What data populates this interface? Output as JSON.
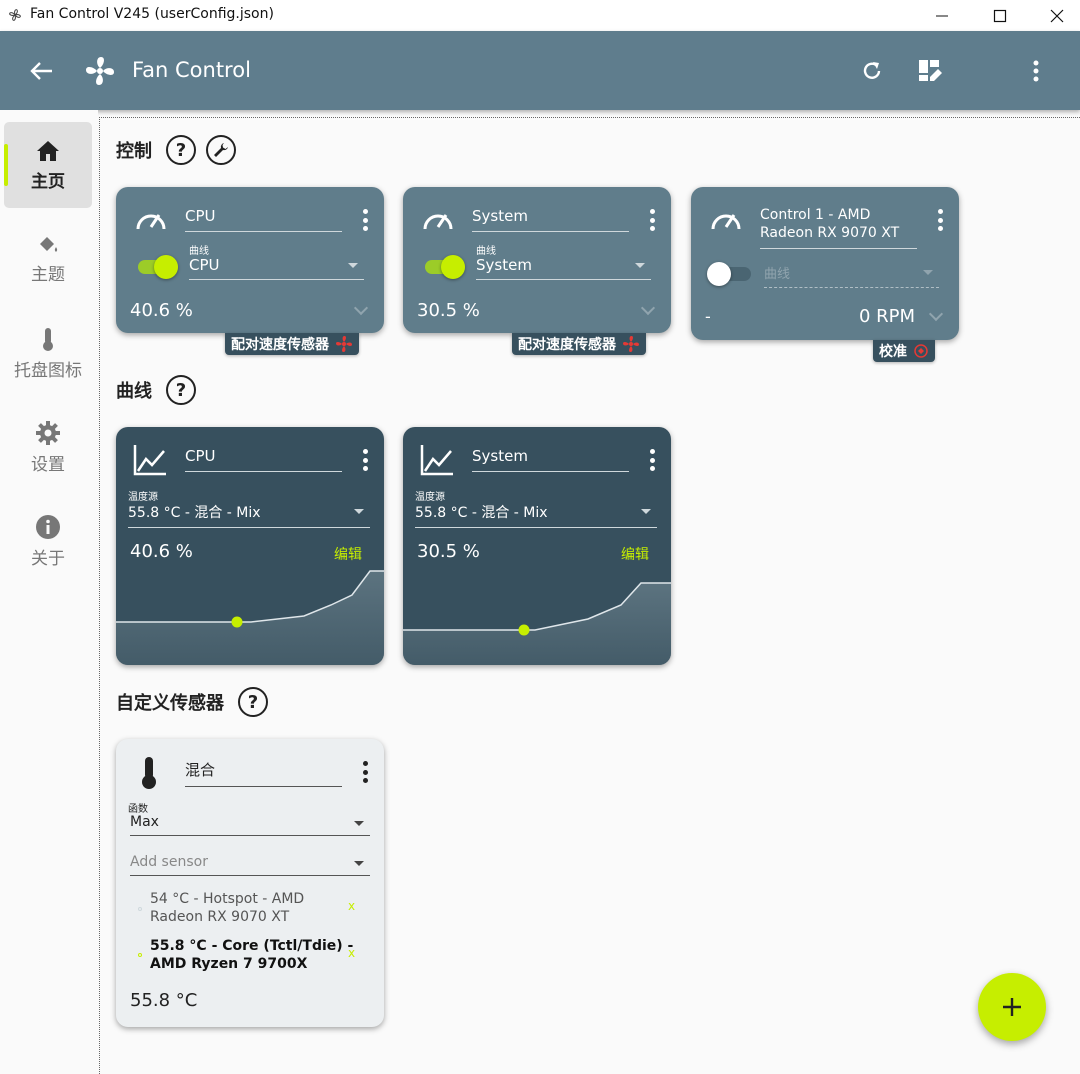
{
  "window": {
    "title": "Fan Control V245 (userConfig.json)"
  },
  "appbar": {
    "title": "Fan Control",
    "back_icon": "back-arrow-icon",
    "refresh_icon": "refresh-icon",
    "dashboard_icon": "dashboard-edit-icon",
    "menu_icon": "more-vert-icon"
  },
  "colors": {
    "accent": "#c6ee00",
    "appbar": "#5f7d8d",
    "card_control": "#607d8b",
    "card_curve": "#37505e",
    "card_custom": "#eceff1",
    "fan_red": "#e53935"
  },
  "sidebar": {
    "items": [
      {
        "label": "主页",
        "icon": "home-icon",
        "active": true
      },
      {
        "label": "主题",
        "icon": "paint-bucket-icon",
        "active": false
      },
      {
        "label": "托盘图标",
        "icon": "thermometer-icon",
        "active": false
      },
      {
        "label": "设置",
        "icon": "gear-icon",
        "active": false
      },
      {
        "label": "关于",
        "icon": "info-icon",
        "active": false
      }
    ]
  },
  "sections": {
    "controls": {
      "title": "控制",
      "help": "?"
    },
    "curves": {
      "title": "曲线",
      "help": "?"
    },
    "custom": {
      "title": "自定义传感器",
      "help": "?"
    }
  },
  "controls": [
    {
      "name": "CPU",
      "curve_label": "曲线",
      "curve_value": "CPU",
      "enabled": true,
      "value": "40.6 %",
      "tag": "配对速度传感器"
    },
    {
      "name": "System",
      "curve_label": "曲线",
      "curve_value": "System",
      "enabled": true,
      "value": "30.5 %",
      "tag": "配对速度传感器"
    },
    {
      "name": "Control 1 - AMD Radeon RX 9070 XT",
      "curve_label": "曲线",
      "curve_value": "",
      "enabled": false,
      "value_left": "-",
      "value": "0 RPM",
      "tag": "校准"
    }
  ],
  "curves": [
    {
      "name": "CPU",
      "source_label": "温度源",
      "source_value": "55.8 °C - 混合 - Mix",
      "value": "40.6 %",
      "edit": "编辑"
    },
    {
      "name": "System",
      "source_label": "温度源",
      "source_value": "55.8 °C - 混合 - Mix",
      "value": "30.5 %",
      "edit": "编辑"
    }
  ],
  "custom_sensor": {
    "name": "混合",
    "function_label": "函数",
    "function_value": "Max",
    "add_placeholder": "Add sensor",
    "sensors": [
      {
        "line1": "54 °C - Hotspot - AMD",
        "line2": "Radeon RX 9070 XT",
        "remove": "x",
        "bold": false
      },
      {
        "line1": "55.8 °C - Core (Tctl/Tdie) -",
        "line2": "AMD Ryzen 7 9700X",
        "remove": "x",
        "bold": true
      }
    ],
    "value": "55.8 °C"
  },
  "fab": {
    "icon": "plus-icon"
  }
}
